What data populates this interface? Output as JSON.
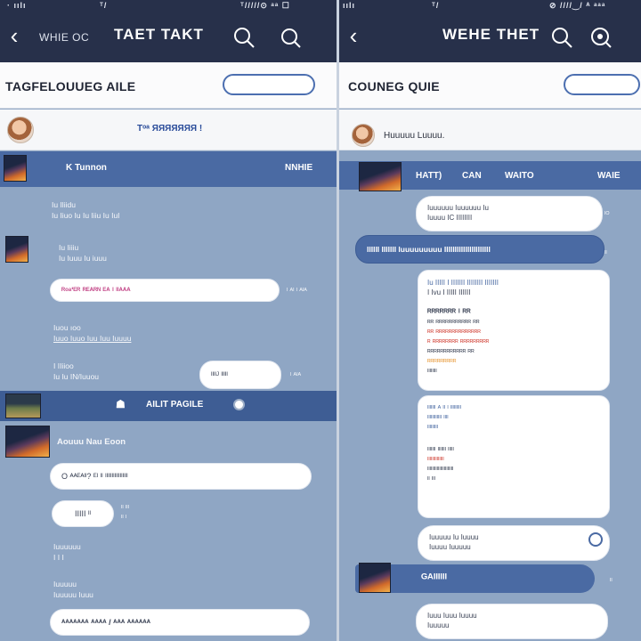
{
  "left": {
    "statusbar": {
      "left": "· ıılı",
      "center": "ᵀ/",
      "right": "ᵀ/////⊙ ᵃᵃ ☐"
    },
    "topbar": {
      "sub": "WHIE OC",
      "title": "TAET TAKT"
    },
    "subhead": {
      "heading": "TAGFELOUUEG AILE"
    },
    "profile": {
      "name": "Tᵒᵃ ЯЯЯЯЯЯЯ !"
    },
    "band1": {
      "left": "K Tunnon",
      "right": "NNHIE"
    },
    "messages": [
      {
        "line1": "Iu Iliidu",
        "line2": "Iu Iiuo Iu  Iu Iiiu Iu IuI"
      },
      {
        "line1": "Iu Iiiiu",
        "line2": "Iu  Iuuu Iu iuuu"
      }
    ],
    "bubble1": {
      "text": "ᴿᵒᵃʹᴱᴿ ᴿᴱᴬᴿᴺ ᴱᴬ  ᴵ  ᴵᴵᴬᴬᴬ",
      "side": "ᴵ ᴬᴵ ᴵ ᴬᴵᴬ"
    },
    "message3": {
      "line1": "Iuou ıoo",
      "line2": "Iuuo  Iuuo Iuu  Iuu Iuuuu"
    },
    "message4": {
      "line1": "I IIiioo",
      "line2": "Iu Iu  IN/Iuuou"
    },
    "bubble2": {
      "text": "ᴵᴵᴵᴵᴶ ᴵᴵᴵᴵᴵ",
      "side": "ᴵ ᴬᴵᴬ"
    },
    "band2": {
      "text": "AILIT PAGILE"
    },
    "message5": {
      "text": "Aouuu Nau Eoon"
    },
    "bubble3": {
      "text": "O ᴬᴬᴱᴬᴵᴵ?  ᴱᴵ  ᴵᴵ  ᴵᴵᴵᴵᴵᴵᴵᴵᴵᴵᴵᴵᴵᴵᴵᴵᴵ"
    },
    "bubble4": {
      "text": "IIIII ᴵᴵ",
      "side": "ᴵᴵ ᴵᴵᴵ\nᴵᴵ ᴵ"
    },
    "message6": {
      "line1": "Iuuuuuu",
      "line2": "I I  I"
    },
    "message7": {
      "line1": "Iuuuuu",
      "line2": "Iuuuuu Iuuu"
    },
    "bubble5": {
      "text": "ᴬᴬᴬᴬᴬᴬᴬ  ᴬᴬᴬᴬ / ᴬᴬᴬ  ᴬᴬᴬᴬᴬᴬ"
    }
  },
  "right": {
    "statusbar": {
      "left": "ıılı",
      "center": "ᵀ/",
      "right": "⊘ ////‿/ ᴬ ᵃᵃᵃ"
    },
    "topbar": {
      "title": "WEHE THET"
    },
    "subhead": {
      "heading": "COUNEG QUIE"
    },
    "profile": {
      "name": "Huuuuu Luuuu."
    },
    "band1": {
      "items": [
        "HATT)",
        "CAN",
        "WAITO",
        "WAIE"
      ]
    },
    "bubble1": {
      "line1": "Iuuuuuu Iuuuuuu Iu",
      "line2": "Iuuuu IC IIIIIIII",
      "side": "ᴵᴼ"
    },
    "blue_bar": {
      "text": "IIIIII IIIIIII Iuuuuuuuuu IIIIIIIIIIIIIIIIIIIIII"
    },
    "card1": {
      "line1": "Iu IIIII I  IIIIIII   IIIIIIII  IIIIIII",
      "line2": "I Ivu  I IIIII IIIIII",
      "line3": "ᴿᴿᴿᴿᴿᴿᴿ ᴵ ᴿᴿ",
      "line4": "ᴿᴿ ᴿᴿᴿᴿᴿᴿᴿᴿᴿᴿᴿ ᴿᴿ",
      "line5": "ᴿᴿ ᴿᴿᴿᴿᴿᴿᴿᴿᴿᴿᴿᴿᴿᴿ",
      "line6": "ᴿ ᴿᴿᴿᴿᴿᴿᴿᴿ ᴿᴿᴿᴿᴿᴿᴿᴿᴿ",
      "line7": "ᴿᴿᴿᴿᴿᴿᴿᴿᴿᴿᴿᴿ ᴿᴿ",
      "line8": "ᴿᴿᴿᴿᴿᴿᴿᴿᴿ",
      "line9": "ᴵᴵᴵᴵᴵᴵᴵᴵ"
    },
    "card2": {
      "line1": "ᴵᴵᴵᴵᴵᴵᴵ ᴬ ᴵᴵ ᴵ  ᴵᴵᴵᴵᴵᴵᴵᴵᴵ",
      "line2": "ᴵᴵᴵᴵᴵᴵᴵᴵᴵᴵᴵᴵ  ᴵᴵᴵᴵ",
      "line3": "ᴵᴵᴵᴵᴵᴵᴵᴵᴵ",
      "line4": "ᴵᴵᴵᴵᴵᴵᴵ  ᴵᴵᴵᴵᴵᴵᴵ  ᴵᴵᴵᴵᴵ",
      "line5": "ᴵᴵᴵᴵᴵᴵᴵᴵᴵᴵᴵᴵᴵᴵ",
      "line6": "ᴵᴵᴵᴵᴵᴵᴵᴵᴵᴵᴵᴵᴵᴵᴵᴵᴵᴵᴵᴵᴵᴵ",
      "line7": "ᴵᴵ  ᴵᴵᴵ"
    },
    "bubble2": {
      "line1": "Iuuuuu  Iu Iuuuu",
      "line2": "Iuuuu Iuuuuu"
    },
    "band2": {
      "text": "ᴳᴬᴵᴵᴵᴵᴵᴵ",
      "side": "ᴵᴵ"
    },
    "bubble3": {
      "line1": "Iuuu Iuuu Iuuuu",
      "line2": "Iuuuuu"
    }
  },
  "colors": {
    "header": "#27304a",
    "band": "#4a6aa3",
    "background": "#8fa6c4",
    "accent": "#4c6fb0"
  }
}
